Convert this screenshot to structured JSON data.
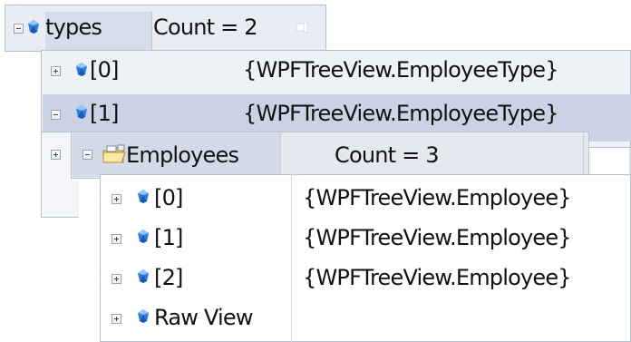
{
  "tooltip": {
    "types": {
      "name": "types",
      "value": "Count = 2"
    },
    "types_items": [
      {
        "name": "[0]",
        "value": "{WPFTreeView.EmployeeType}"
      },
      {
        "name": "[1]",
        "value": "{WPFTreeView.EmployeeType}"
      }
    ],
    "employees": {
      "name": "Employees",
      "value": "Count = 3",
      "items": [
        {
          "name": "[0]",
          "value": "{WPFTreeView.Employee}"
        },
        {
          "name": "[1]",
          "value": "{WPFTreeView.Employee}"
        },
        {
          "name": "[2]",
          "value": "{WPFTreeView.Employee}"
        },
        {
          "name": "Raw View",
          "value": ""
        }
      ]
    }
  },
  "colors": {
    "gem": "#3a86e8",
    "highlight": "#c9d3e3",
    "border": "#b8c0cb"
  },
  "icons": {
    "expand": "plus-box-icon",
    "collapse": "minus-box-icon",
    "property": "blue-gem-icon",
    "collection": "folder-icon",
    "pin": "pin-icon"
  }
}
